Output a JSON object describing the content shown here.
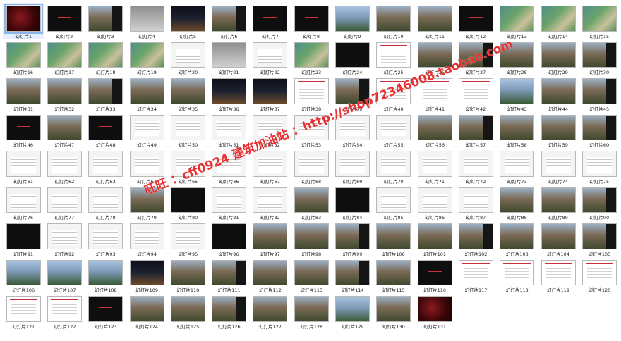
{
  "label_prefix": "幻灯片",
  "selected_index": 0,
  "watermark_text": "旺旺 ：cff0924  建筑加油站 ：http://shop72346008.taobao.com",
  "colors": {
    "dark": "#0e0e0e",
    "red_title": "#3a0608",
    "aerial": "#6aa36a",
    "photo": "#7a6a55",
    "plan": "#f4f4f4",
    "doc": "#ffffff",
    "sky": "#7d9ab8",
    "night": "#1d2230",
    "gray": "#8f8f8f",
    "accent_red": "#c8313a"
  },
  "slides": [
    {
      "n": 1,
      "t": "red_title"
    },
    {
      "n": 2,
      "t": "dark"
    },
    {
      "n": 3,
      "t": "photo"
    },
    {
      "n": 4,
      "t": "gray"
    },
    {
      "n": 5,
      "t": "night"
    },
    {
      "n": 6,
      "t": "photo"
    },
    {
      "n": 7,
      "t": "dark"
    },
    {
      "n": 8,
      "t": "dark"
    },
    {
      "n": 9,
      "t": "sky"
    },
    {
      "n": 10,
      "t": "photo"
    },
    {
      "n": 11,
      "t": "photo"
    },
    {
      "n": 12,
      "t": "dark"
    },
    {
      "n": 13,
      "t": "aerial"
    },
    {
      "n": 14,
      "t": "aerial"
    },
    {
      "n": 15,
      "t": "aerial"
    },
    {
      "n": 16,
      "t": "aerial"
    },
    {
      "n": 17,
      "t": "aerial"
    },
    {
      "n": 18,
      "t": "aerial"
    },
    {
      "n": 19,
      "t": "aerial"
    },
    {
      "n": 20,
      "t": "plan"
    },
    {
      "n": 21,
      "t": "gray"
    },
    {
      "n": 22,
      "t": "plan"
    },
    {
      "n": 23,
      "t": "aerial"
    },
    {
      "n": 24,
      "t": "dark"
    },
    {
      "n": 25,
      "t": "doc"
    },
    {
      "n": 26,
      "t": "photo"
    },
    {
      "n": 27,
      "t": "photo"
    },
    {
      "n": 28,
      "t": "photo"
    },
    {
      "n": 29,
      "t": "photo"
    },
    {
      "n": 30,
      "t": "photo"
    },
    {
      "n": 31,
      "t": "photo"
    },
    {
      "n": 32,
      "t": "photo"
    },
    {
      "n": 33,
      "t": "photo"
    },
    {
      "n": 34,
      "t": "photo"
    },
    {
      "n": 35,
      "t": "photo"
    },
    {
      "n": 36,
      "t": "night"
    },
    {
      "n": 37,
      "t": "night"
    },
    {
      "n": 38,
      "t": "doc"
    },
    {
      "n": 39,
      "t": "photo"
    },
    {
      "n": 40,
      "t": "doc"
    },
    {
      "n": 41,
      "t": "doc"
    },
    {
      "n": 42,
      "t": "doc"
    },
    {
      "n": 43,
      "t": "sky"
    },
    {
      "n": 44,
      "t": "photo"
    },
    {
      "n": 45,
      "t": "photo"
    },
    {
      "n": 46,
      "t": "dark"
    },
    {
      "n": 47,
      "t": "photo"
    },
    {
      "n": 48,
      "t": "dark"
    },
    {
      "n": 49,
      "t": "plan"
    },
    {
      "n": 50,
      "t": "plan"
    },
    {
      "n": 51,
      "t": "plan"
    },
    {
      "n": 52,
      "t": "plan"
    },
    {
      "n": 53,
      "t": "plan"
    },
    {
      "n": 54,
      "t": "plan"
    },
    {
      "n": 55,
      "t": "plan"
    },
    {
      "n": 56,
      "t": "photo"
    },
    {
      "n": 57,
      "t": "photo"
    },
    {
      "n": 58,
      "t": "photo"
    },
    {
      "n": 59,
      "t": "photo"
    },
    {
      "n": 60,
      "t": "photo"
    },
    {
      "n": 61,
      "t": "plan"
    },
    {
      "n": 62,
      "t": "plan"
    },
    {
      "n": 63,
      "t": "plan"
    },
    {
      "n": 64,
      "t": "plan"
    },
    {
      "n": 65,
      "t": "plan"
    },
    {
      "n": 66,
      "t": "plan"
    },
    {
      "n": 67,
      "t": "plan"
    },
    {
      "n": 68,
      "t": "plan"
    },
    {
      "n": 69,
      "t": "plan"
    },
    {
      "n": 70,
      "t": "plan"
    },
    {
      "n": 71,
      "t": "plan"
    },
    {
      "n": 72,
      "t": "plan"
    },
    {
      "n": 73,
      "t": "plan"
    },
    {
      "n": 74,
      "t": "plan"
    },
    {
      "n": 75,
      "t": "plan"
    },
    {
      "n": 76,
      "t": "plan"
    },
    {
      "n": 77,
      "t": "plan"
    },
    {
      "n": 78,
      "t": "plan"
    },
    {
      "n": 79,
      "t": "photo"
    },
    {
      "n": 80,
      "t": "dark"
    },
    {
      "n": 81,
      "t": "plan"
    },
    {
      "n": 82,
      "t": "plan"
    },
    {
      "n": 83,
      "t": "photo"
    },
    {
      "n": 84,
      "t": "dark"
    },
    {
      "n": 85,
      "t": "plan"
    },
    {
      "n": 86,
      "t": "plan"
    },
    {
      "n": 87,
      "t": "plan"
    },
    {
      "n": 88,
      "t": "photo"
    },
    {
      "n": 89,
      "t": "photo"
    },
    {
      "n": 90,
      "t": "photo"
    },
    {
      "n": 91,
      "t": "dark"
    },
    {
      "n": 92,
      "t": "plan"
    },
    {
      "n": 93,
      "t": "plan"
    },
    {
      "n": 94,
      "t": "plan"
    },
    {
      "n": 95,
      "t": "plan"
    },
    {
      "n": 96,
      "t": "dark"
    },
    {
      "n": 97,
      "t": "photo"
    },
    {
      "n": 98,
      "t": "photo"
    },
    {
      "n": 99,
      "t": "photo"
    },
    {
      "n": 100,
      "t": "photo"
    },
    {
      "n": 101,
      "t": "photo"
    },
    {
      "n": 102,
      "t": "photo"
    },
    {
      "n": 103,
      "t": "photo"
    },
    {
      "n": 104,
      "t": "photo"
    },
    {
      "n": 105,
      "t": "photo"
    },
    {
      "n": 106,
      "t": "sky"
    },
    {
      "n": 107,
      "t": "sky"
    },
    {
      "n": 108,
      "t": "sky"
    },
    {
      "n": 109,
      "t": "night"
    },
    {
      "n": 110,
      "t": "photo"
    },
    {
      "n": 111,
      "t": "photo"
    },
    {
      "n": 112,
      "t": "photo"
    },
    {
      "n": 113,
      "t": "photo"
    },
    {
      "n": 114,
      "t": "photo"
    },
    {
      "n": 115,
      "t": "photo"
    },
    {
      "n": 116,
      "t": "dark"
    },
    {
      "n": 117,
      "t": "doc"
    },
    {
      "n": 118,
      "t": "doc"
    },
    {
      "n": 119,
      "t": "doc"
    },
    {
      "n": 120,
      "t": "doc"
    },
    {
      "n": 121,
      "t": "doc"
    },
    {
      "n": 122,
      "t": "doc"
    },
    {
      "n": 123,
      "t": "dark"
    },
    {
      "n": 124,
      "t": "photo"
    },
    {
      "n": 125,
      "t": "photo"
    },
    {
      "n": 126,
      "t": "photo"
    },
    {
      "n": 127,
      "t": "photo"
    },
    {
      "n": 128,
      "t": "photo"
    },
    {
      "n": 129,
      "t": "sky"
    },
    {
      "n": 130,
      "t": "photo"
    },
    {
      "n": 131,
      "t": "red_title"
    }
  ]
}
